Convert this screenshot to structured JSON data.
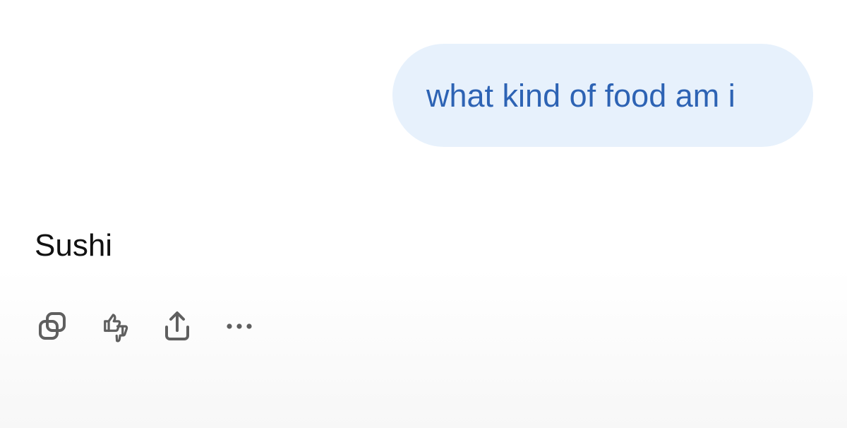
{
  "conversation": {
    "user_message": "what kind of food am i",
    "assistant_message": "Sushi"
  },
  "actions": {
    "copy_icon": "copy-icon",
    "feedback_icon": "thumbs-up-down-icon",
    "share_icon": "share-icon",
    "more_icon": "more-horizontal-icon"
  },
  "colors": {
    "user_bubble_bg": "#e7f1fc",
    "user_text": "#2d63b4",
    "assistant_text": "#111111",
    "icon": "#5f5f5f"
  }
}
